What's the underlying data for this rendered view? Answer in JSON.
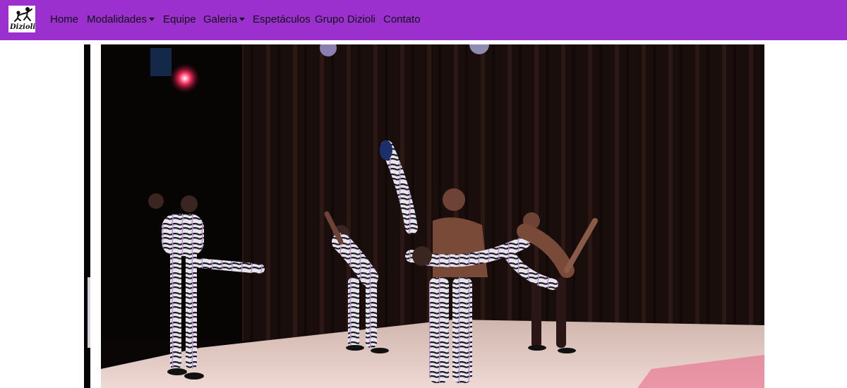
{
  "navbar": {
    "brand": {
      "logo_text": "Dizioli"
    },
    "items": [
      {
        "label": "Home"
      },
      {
        "label": "Modalidades",
        "dropdown": true
      },
      {
        "label": "Equipe"
      },
      {
        "label": "Galeria",
        "dropdown": true
      },
      {
        "label": "Espetáculos"
      },
      {
        "label": "Grupo Dizioli"
      },
      {
        "label": "Contato"
      }
    ]
  },
  "colors": {
    "navbar_bg": "#9b30cf",
    "nav_text": "#111111",
    "page_bg": "#ffffff"
  }
}
